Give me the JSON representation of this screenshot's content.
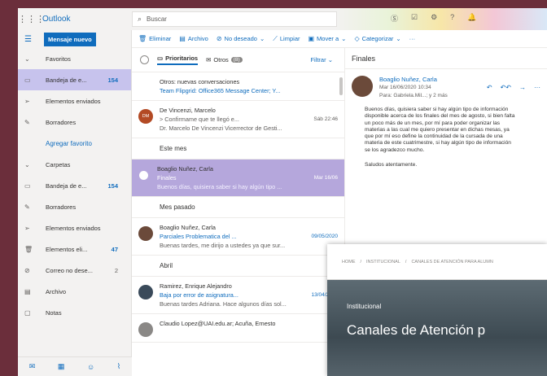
{
  "app": {
    "name": "Outlook"
  },
  "search": {
    "placeholder": "Buscar"
  },
  "topbar": {
    "icons": [
      "skype-icon",
      "todo-icon",
      "settings-icon",
      "help-icon",
      "notifications-icon"
    ]
  },
  "newmail": {
    "label": "Mensaje nuevo"
  },
  "toolbar": {
    "delete": "Eliminar",
    "archive": "Archivo",
    "junk": "No deseado",
    "sweep": "Limpiar",
    "move": "Mover a",
    "categorize": "Categorizar",
    "more": "···"
  },
  "nav": {
    "favorites": "Favoritos",
    "inbox_fav": {
      "label": "Bandeja de e...",
      "count": "154"
    },
    "sent_fav": "Elementos enviados",
    "drafts_fav": "Borradores",
    "add_favorite": "Agregar favorito",
    "folders": "Carpetas",
    "inbox": {
      "label": "Bandeja de e...",
      "count": "154"
    },
    "drafts": "Borradores",
    "sent": "Elementos enviados",
    "deleted": {
      "label": "Elementos eli...",
      "count": "47"
    },
    "junk": {
      "label": "Correo no dese...",
      "count": "2"
    },
    "archive": "Archivo",
    "notes": "Notas"
  },
  "list": {
    "tab_focused": "Prioritarios",
    "tab_other": "Otros",
    "other_badge": "(8)",
    "filter": "Filtrar",
    "banner": {
      "title": "Otros: nuevas conversaciones",
      "subtitle": "Team Flipgrid: Office365 Message Center; Y..."
    },
    "groups": {
      "this_month": "Este mes",
      "last_month": "Mes pasado",
      "april": "Abril"
    },
    "messages": [
      {
        "initials": "DM",
        "from": "De Vincenzi, Marcelo",
        "subject": "> Confirmame que te llegó e...",
        "date": "Sáb 22:46",
        "preview": "Dr. Marcelo De Vincenzi Vicerrector de Gesti..."
      },
      {
        "from": "Boaglio Nuñez, Carla",
        "subject": "Finales",
        "date": "Mar 16/06",
        "preview": "Buenos días, quisiera saber si hay algún tipo ..."
      },
      {
        "from": "Boaglio Nuñez, Carla",
        "subject": "Parciales Problematica del ...",
        "date": "09/05/2020",
        "preview": "Buenas tardes, me dirijo a ustedes ya que sur..."
      },
      {
        "from": "Ramirez, Enrique Alejandro",
        "subject": "Baja por error de asignatura...",
        "date": "13/04/2020",
        "preview": "Buenas tardes Adriana. Hace algunos días sol..."
      },
      {
        "from": "Claudio Lopez@UAI.edu.ar; Acuña, Ernesto"
      }
    ]
  },
  "reading": {
    "title": "Finales",
    "sender": "Boaglio Nuñez, Carla",
    "date": "Mar 16/06/2020 10:34",
    "to": "Para: Gabriela.Mil...; y 2 más",
    "body": "Buenos días, quisiera saber si hay algún tipo de información disponible acerca de los finales del mes de agosto, si bien falta un poco más de un mes, por mí para poder organizar las materias a las cual me quiero presentar en dichas mesas, ya que por mí eso define la continuidad de la cursada de una materia de este cuatrimestre, si hay algún tipo de información se los agradezco mucho.",
    "signoff": "Saludos atentamente."
  },
  "overlay": {
    "breadcrumb": [
      "HOME",
      "INSTITUCIONAL",
      "CANALES DE ATENCIÓN PARA ALUMN"
    ],
    "section": "Institucional",
    "title": "Canales de Atención p"
  },
  "colors": {
    "accent": "#0f6cbd",
    "selected_nav": "#c7c3ed",
    "selected_msg": "#b5a7dc",
    "border": "#6b2e3b"
  }
}
